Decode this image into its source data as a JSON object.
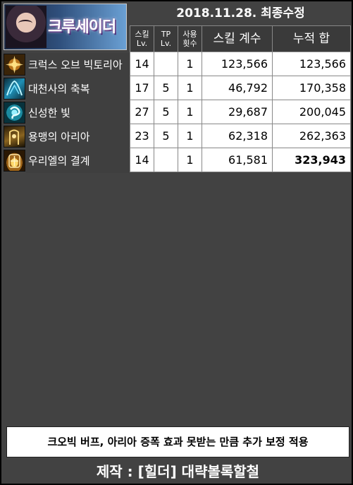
{
  "banner": {
    "title": "크루세이더"
  },
  "header": {
    "date_title": "2018.11.28. 최종수정"
  },
  "table": {
    "columns": {
      "skill_lv": "스킬\nLv.",
      "tp_lv": "TP\nLv.",
      "use_count": "사용\n횟수",
      "skill_coef": "스킬 계수",
      "cumulative": "누적 합"
    },
    "rows": [
      {
        "name": "크럭스 오브 빅토리아",
        "icon": "crux-of-victoria-icon",
        "skill_lv": "14",
        "tp_lv": "",
        "use_count": "1",
        "skill_coef": "123,566",
        "cumulative": "123,566"
      },
      {
        "name": "대천사의 축복",
        "icon": "archangel-blessing-icon",
        "skill_lv": "17",
        "tp_lv": "5",
        "use_count": "1",
        "skill_coef": "46,792",
        "cumulative": "170,358"
      },
      {
        "name": "신성한 빛",
        "icon": "holy-light-icon",
        "skill_lv": "27",
        "tp_lv": "5",
        "use_count": "1",
        "skill_coef": "29,687",
        "cumulative": "200,045"
      },
      {
        "name": "용맹의 아리아",
        "icon": "aria-of-courage-icon",
        "skill_lv": "23",
        "tp_lv": "5",
        "use_count": "1",
        "skill_coef": "62,318",
        "cumulative": "262,363"
      },
      {
        "name": "우리엘의 결계",
        "icon": "uriel-barrier-icon",
        "skill_lv": "14",
        "tp_lv": "",
        "use_count": "1",
        "skill_coef": "61,581",
        "cumulative": "323,943"
      }
    ]
  },
  "notice": {
    "text": "크오빅 버프, 아리아 증폭 효과 못받는 만큼 추가 보정 적용"
  },
  "footer": {
    "credit": "제작 : [힐더] 대략볼록할철"
  },
  "colors": {
    "background": "#424242",
    "outer_border": "#000000",
    "table_header": "#3a3a3a",
    "cell_bg": "#ffffff"
  }
}
